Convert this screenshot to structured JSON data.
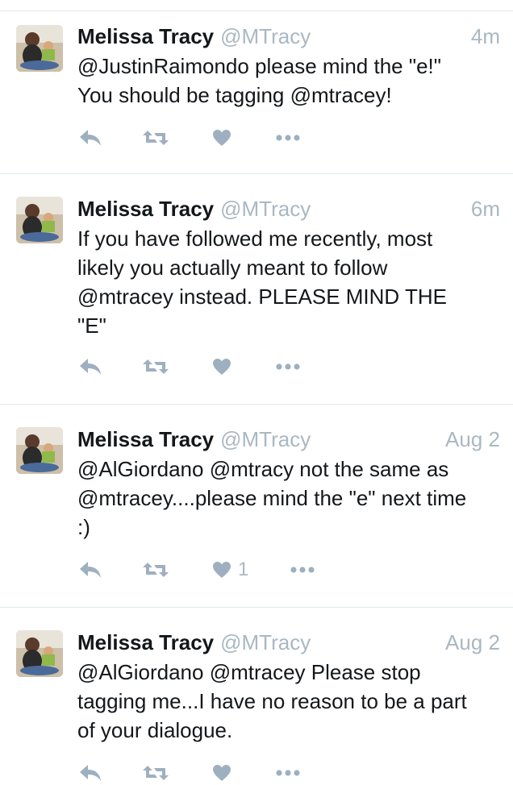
{
  "colors": {
    "text": "#14171a",
    "muted": "#aab8c2",
    "icon": "#9eb0bf",
    "divider": "#e1e8ed"
  },
  "icons": [
    "reply-icon",
    "retweet-icon",
    "heart-icon",
    "more-icon"
  ],
  "tweets": [
    {
      "name": "Melissa Tracy",
      "handle": "@MTracy",
      "time": "4m",
      "text": "@JustinRaimondo please mind the \"e!\"\nYou should be tagging @mtracey!",
      "likes": ""
    },
    {
      "name": "Melissa Tracy",
      "handle": "@MTracy",
      "time": "6m",
      "text": "If you have followed me recently, most\nlikely you actually meant to follow\n@mtracey instead. PLEASE MIND THE\n\"E\"",
      "likes": ""
    },
    {
      "name": "Melissa Tracy",
      "handle": "@MTracy",
      "time": "Aug 2",
      "text": "@AlGiordano @mtracy not the same as\n@mtracey....please mind the \"e\" next time\n:)",
      "likes": "1"
    },
    {
      "name": "Melissa Tracy",
      "handle": "@MTracy",
      "time": "Aug 2",
      "text": "@AlGiordano @mtracey Please stop\ntagging me...I have no reason to be a part\nof your dialogue.",
      "likes": ""
    }
  ]
}
